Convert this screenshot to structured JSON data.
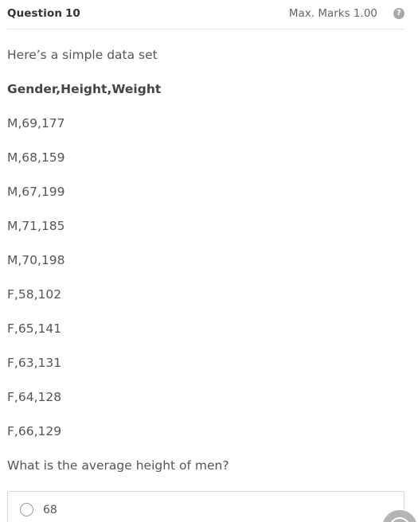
{
  "question": {
    "label": "Question",
    "number": "10",
    "max_marks": "Max. Marks 1.00",
    "help_icon": "?"
  },
  "body": {
    "intro": "Here’s a simple data set",
    "header_row": "Gender,Height,Weight",
    "rows": [
      "M,69,177",
      "M,68,159",
      "M,67,199",
      "M,71,185",
      "M,70,198",
      "F,58,102",
      "F,65,141",
      "F,63,131",
      "F,64,128",
      "F,66,129"
    ],
    "prompt": "What is the average height of men?"
  },
  "options": [
    {
      "label": "68",
      "selected": false
    }
  ],
  "icons": {
    "help": "help-circle-icon",
    "fab": "chat-bubble-icon"
  },
  "colors": {
    "text": "#555555",
    "border": "#d6d6d6",
    "icon": "#a9a9a9"
  }
}
